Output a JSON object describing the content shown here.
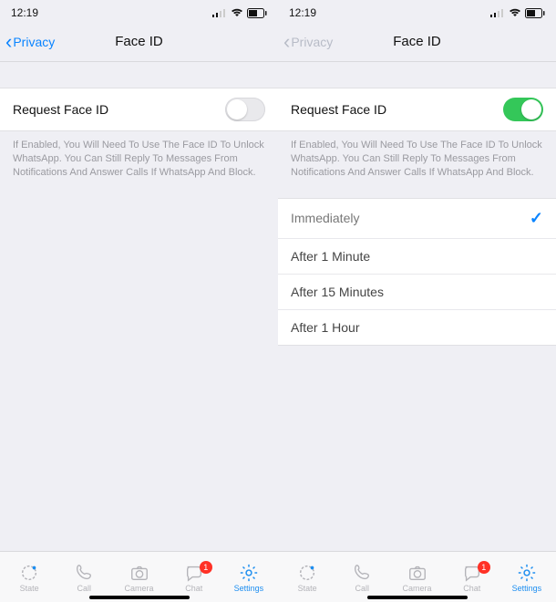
{
  "status": {
    "time": "12:19"
  },
  "nav": {
    "back_label": "Privacy",
    "title": "Face ID"
  },
  "request": {
    "label": "Request Face ID",
    "note": "If Enabled, You Will Need To Use The Face ID To Unlock WhatsApp. You Can Still Reply To Messages From Notifications And Answer Calls If WhatsApp And Block."
  },
  "options": {
    "immediately": "Immediately",
    "after1min": "After 1 Minute",
    "after15min": "After 15 Minutes",
    "after1hour": "After 1 Hour"
  },
  "tabs": {
    "state": "State",
    "call": "Call",
    "camera": "Camera",
    "chat": "Chat",
    "settings": "Settings",
    "chat_badge": "1"
  }
}
